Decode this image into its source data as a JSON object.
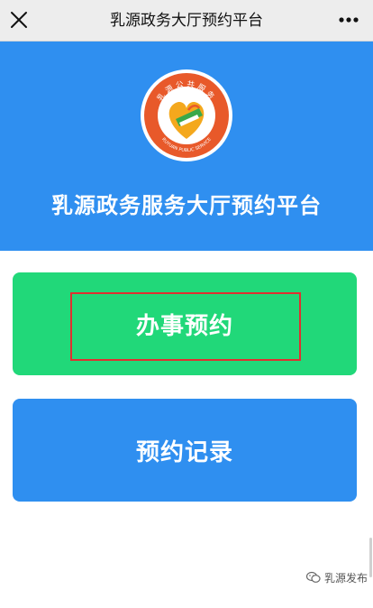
{
  "topbar": {
    "title": "乳源政务大厅预约平台",
    "close_icon": "close-icon",
    "more_icon": "more-icon"
  },
  "hero": {
    "title": "乳源政务服务大厅预约平台",
    "logo_top_text": "乳源公共服务",
    "logo_bottom_text": "RUYUAN PUBLIC SERVICE"
  },
  "buttons": {
    "appointment_label": "办事预约",
    "records_label": "预约记录"
  },
  "watermark": {
    "text": "乳源发布"
  },
  "colors": {
    "hero_blue": "#2f8ff0",
    "button_green": "#21d879",
    "highlight_red": "#e03030"
  }
}
